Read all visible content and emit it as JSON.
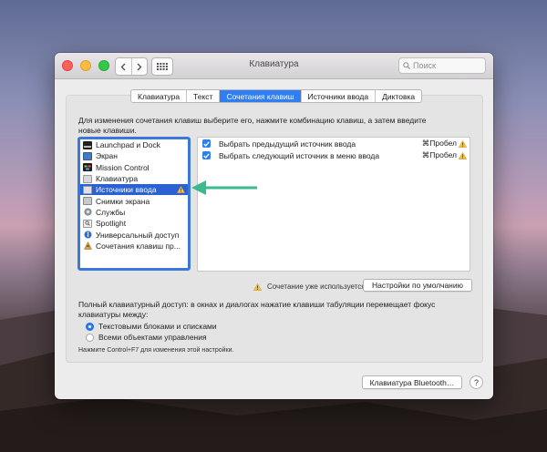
{
  "window": {
    "title": "Клавиатура",
    "search_placeholder": "Поиск"
  },
  "tabs": [
    {
      "label": "Клавиатура",
      "active": false
    },
    {
      "label": "Текст",
      "active": false
    },
    {
      "label": "Сочетания клавиш",
      "active": true
    },
    {
      "label": "Источники ввода",
      "active": false
    },
    {
      "label": "Диктовка",
      "active": false
    }
  ],
  "instruction": "Для изменения сочетания клавиш выберите его, нажмите комбинацию клавиш, а затем введите новые клавиши.",
  "categories": [
    {
      "label": "Launchpad и Dock",
      "icon": "launchpad-dock-icon"
    },
    {
      "label": "Экран",
      "icon": "display-icon"
    },
    {
      "label": "Mission Control",
      "icon": "mission-control-icon"
    },
    {
      "label": "Клавиатура",
      "icon": "keyboard-icon"
    },
    {
      "label": "Источники ввода",
      "icon": "input-sources-icon",
      "selected": true,
      "warning": true
    },
    {
      "label": "Снимки экрана",
      "icon": "screenshot-icon"
    },
    {
      "label": "Службы",
      "icon": "services-gear-icon"
    },
    {
      "label": "Spotlight",
      "icon": "spotlight-icon"
    },
    {
      "label": "Универсальный доступ",
      "icon": "accessibility-icon"
    },
    {
      "label": "Сочетания клавиш пр...",
      "icon": "app-shortcuts-icon"
    }
  ],
  "shortcuts": [
    {
      "label": "Выбрать предыдущий источник ввода",
      "key": "⌘Пробел",
      "checked": true,
      "warning": true
    },
    {
      "label": "Выбрать следующий источник в меню ввода",
      "key": "⌘Пробел",
      "checked": true,
      "warning": true
    }
  ],
  "conflict_text": "Сочетание уже используется",
  "defaults_button": "Настройки по умолчанию",
  "full_keyboard_access": "Полный клавиатурный доступ: в окнах и диалогах нажатие клавиши табуляции перемещает фокус клавиатуры между:",
  "radio_options": [
    {
      "label": "Текстовыми блоками и списками",
      "selected": true
    },
    {
      "label": "Всеми объектами управления",
      "selected": false
    }
  ],
  "hint": "Нажмите Control+F7 для изменения этой настройки.",
  "bluetooth_button": "Клавиатура Bluetooth…",
  "help_button": "?",
  "colors": {
    "accent": "#2e7cf6",
    "selection": "#2a62d4",
    "annotation_arrow": "#3bb98f",
    "warning": "#f5c243"
  }
}
